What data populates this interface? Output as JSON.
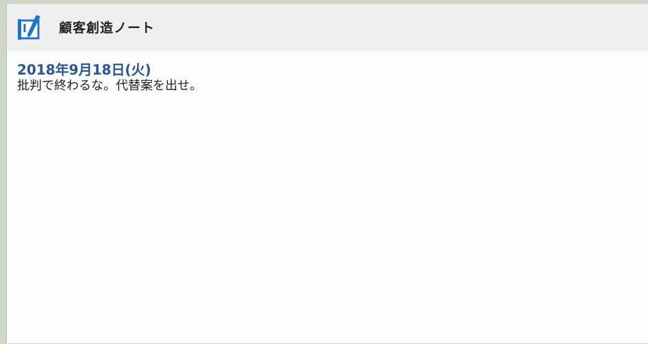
{
  "app": {
    "title": "顧客創造ノート",
    "icon": "notebook-pen-icon",
    "accent_color": "#1f73c8"
  },
  "note": {
    "date": "2018年9月18日(火)",
    "message": "批判で終わるな。代替案を出せ。"
  },
  "colors": {
    "header_bg": "#efefef",
    "date_color": "#2a5590",
    "text_color": "#222222",
    "content_bg": "#fbfcfe"
  }
}
